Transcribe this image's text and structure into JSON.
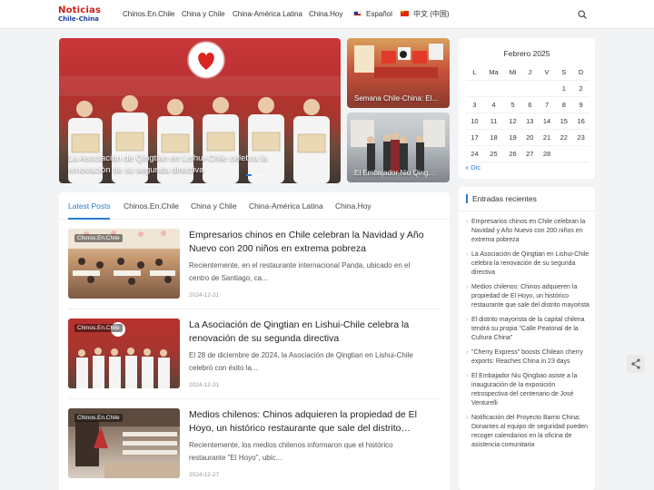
{
  "logo": {
    "line1": "Noticias",
    "line2": "Chile-China"
  },
  "nav": {
    "items": [
      "Chinos.En.Chile",
      "China y Chile",
      "China-América Latina",
      "China.Hoy"
    ],
    "lang_es": "Español",
    "lang_zh": "中文 (中国)"
  },
  "slider": {
    "main_caption": "La Asociación de Qingtian en Lishui-Chile celebra la renovación de su segunda directiva",
    "small1_caption": "Semana Chile-China: El...",
    "small2_caption": "El Embajador Niu Qing..."
  },
  "calendar": {
    "title": "Febrero 2025",
    "weekdays": [
      "L",
      "Ma",
      "Mi",
      "J",
      "V",
      "S",
      "D"
    ],
    "weeks": [
      [
        "",
        "",
        "",
        "",
        "",
        "1",
        "2"
      ],
      [
        "3",
        "4",
        "5",
        "6",
        "7",
        "8",
        "9"
      ],
      [
        "10",
        "11",
        "12",
        "13",
        "14",
        "15",
        "16"
      ],
      [
        "17",
        "18",
        "19",
        "20",
        "21",
        "22",
        "23"
      ],
      [
        "24",
        "25",
        "26",
        "27",
        "28",
        "",
        ""
      ]
    ],
    "prev": "« Dic"
  },
  "posts_tabs": [
    "Latest Posts",
    "Chinos.En.Chile",
    "China y Chile",
    "China-América Latina",
    "China.Hoy"
  ],
  "posts": [
    {
      "badge": "Chinos.En.Chile",
      "title": "Empresarios chinos en Chile celebran la Navidad y Año Nuevo con 200 niños en extrema pobreza",
      "excerpt": "Recientemente, en el restaurante internacional Panda, ubicado en el centro de Santiago, ca...",
      "date": "2024-12-31"
    },
    {
      "badge": "Chinos.En.Chile",
      "title": "La Asociación de Qingtian en Lishui-Chile celebra la renovación de su segunda directiva",
      "excerpt": "El 28 de diciembre de 2024, la Asociación de Qingtian en Lishui-Chile celebró con éxito la...",
      "date": "2024-12-31"
    },
    {
      "badge": "Chinos.En.Chile",
      "title": "Medios chilenos: Chinos adquieren la propiedad de El Hoyo, un histórico restaurante que sale del distrito…",
      "excerpt": "Recientemente, los medios chilenos informaron que el histórico restaurante \"El Hoyo\", ubic...",
      "date": "2024-12-27"
    }
  ],
  "recent": {
    "title": "Entradas recientes",
    "items": [
      "Empresarios chinos en Chile celebran la Navidad y Año Nuevo con 200 niños en extrema pobreza",
      "La Asociación de Qingtian en Lishui-Chile celebra la renovación de su segunda directiva",
      "Medios chilenos: Chinos adquieren la propiedad de El Hoyo, un histórico restaurante que sale del distrito mayorista",
      "El distrito mayorista de la capital chilena tendrá su propia \"Calle Peatonal de la Cultura China\"",
      "\"Cherry Express\" boosts Chilean cherry exports: Reaches China in 23 days",
      "El Embajador Niu Qingbao asiste a la inauguración de la exposición retrospectiva del centenario de José Venturelli",
      "Notificación del Proyecto Barrio China: Donantes al equipo de seguridad pueden recoger calendarios en la oficina de asistencia comunitaria"
    ]
  },
  "colors": {
    "accent": "#2b7cd3",
    "logo_red": "#c81e1e",
    "logo_blue": "#1a3f9b"
  }
}
